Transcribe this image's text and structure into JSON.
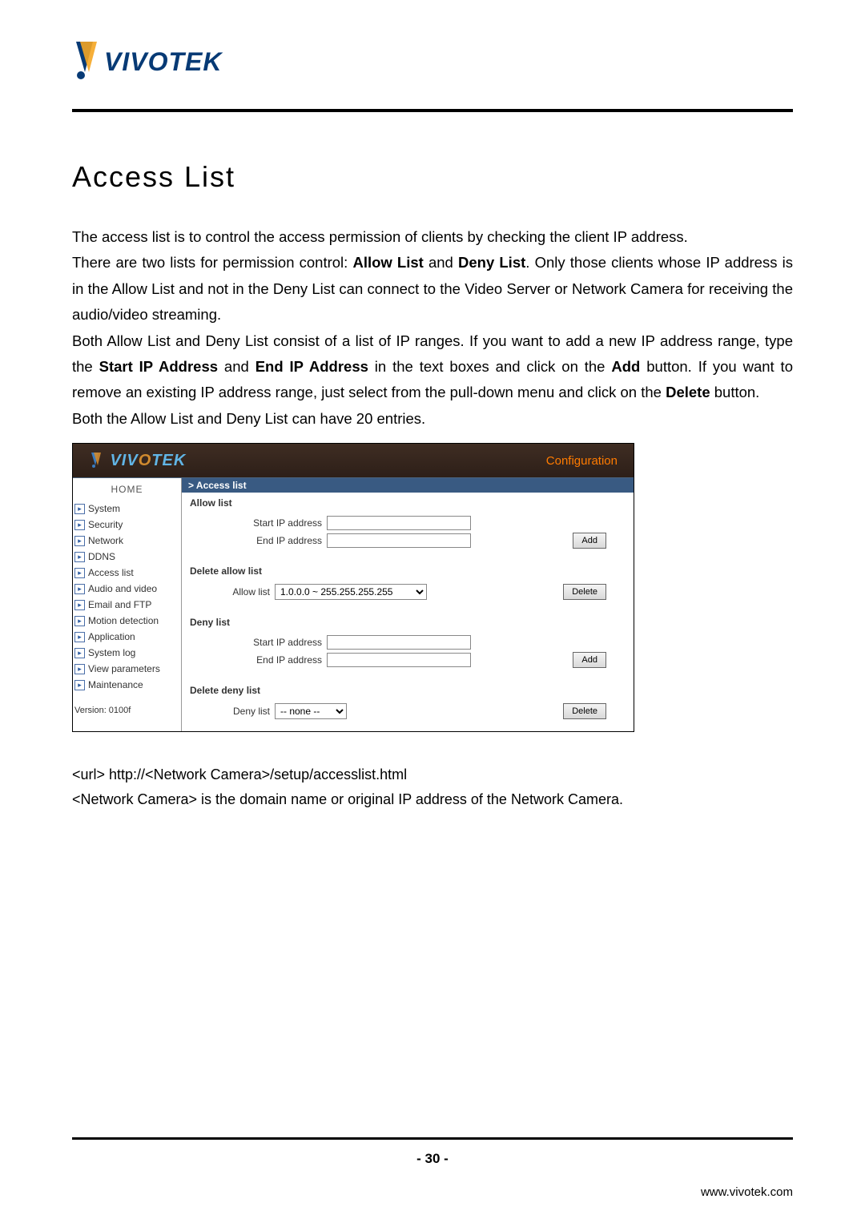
{
  "header": {
    "brand": "VIVOTEK"
  },
  "doc": {
    "title": "Access List",
    "p1_a": "The access list is to control the access permission of clients by checking the client IP address.",
    "p2_a": "There are two lists for permission control: ",
    "p2_b_allow": "Allow List",
    "p2_c": " and ",
    "p2_b_deny": "Deny List",
    "p2_d": ". Only those clients whose IP address is in the Allow List and not in the Deny List can connect to the Video Server or Network Camera for receiving the audio/video streaming.",
    "p3_a": "Both Allow List and Deny List consist of a list of IP ranges. If you want to add a new IP address range, type the ",
    "p3_b_start": "Start IP Address",
    "p3_c": " and ",
    "p3_b_end": "End IP Address",
    "p3_d": " in the text boxes and click on the ",
    "p3_b_add": "Add",
    "p3_e": " button. If you want to remove an existing IP address range, just select from the pull-down menu and click on the ",
    "p3_b_del": "Delete",
    "p3_f": " button.",
    "p4": "Both the Allow List and Deny List can have 20 entries.",
    "url_line_1": "<url> http://<Network Camera>/setup/accesslist.html",
    "url_line_2": "<Network Camera> is the domain name or original IP address of the Network Camera."
  },
  "screenshot": {
    "conf_label": "Configuration",
    "home": "HOME",
    "menu": [
      "System",
      "Security",
      "Network",
      "DDNS",
      "Access list",
      "Audio and video",
      "Email and FTP",
      "Motion detection",
      "Application",
      "System log",
      "View parameters",
      "Maintenance"
    ],
    "version": "Version: 0100f",
    "crumb": "> Access list",
    "allow_title": "Allow list",
    "deny_title": "Deny list",
    "del_allow_title": "Delete allow list",
    "del_deny_title": "Delete deny list",
    "lbl_start": "Start IP address",
    "lbl_end": "End IP address",
    "lbl_allowlist": "Allow list",
    "lbl_denylist": "Deny list",
    "btn_add": "Add",
    "btn_delete": "Delete",
    "allow_select": "1.0.0.0 ~ 255.255.255.255",
    "deny_select": "-- none --"
  },
  "footer": {
    "page_num": "- 30 -",
    "url": "www.vivotek.com"
  }
}
